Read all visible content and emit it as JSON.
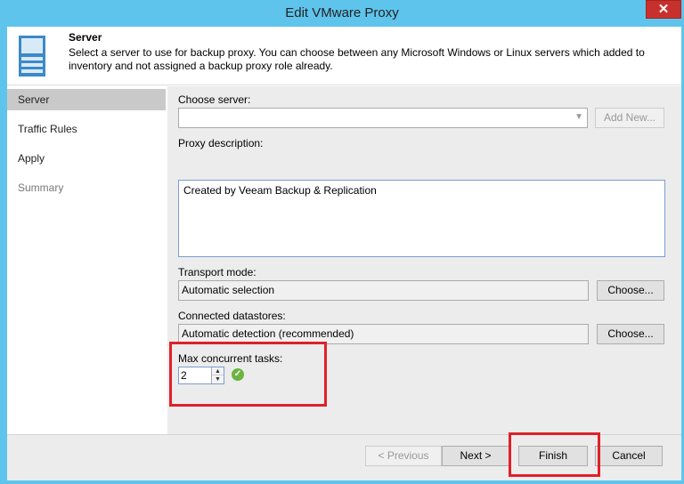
{
  "window": {
    "title": "Edit VMware Proxy",
    "close_glyph": "✕"
  },
  "header": {
    "title": "Server",
    "description": "Select a server to use for backup proxy. You can choose between any Microsoft Windows or Linux servers which added to inventory and not assigned a backup proxy role already.",
    "icon": "server-icon"
  },
  "nav": {
    "items": [
      {
        "label": "Server",
        "state": "active"
      },
      {
        "label": "Traffic Rules",
        "state": "normal"
      },
      {
        "label": "Apply",
        "state": "normal"
      },
      {
        "label": "Summary",
        "state": "disabled"
      }
    ]
  },
  "form": {
    "choose_server_label": "Choose server:",
    "choose_server_value": "",
    "add_new_label": "Add New...",
    "proxy_description_label": "Proxy description:",
    "proxy_description_value": "Created by Veeam Backup & Replication",
    "transport_mode_label": "Transport mode:",
    "transport_mode_value": "Automatic selection",
    "choose_label": "Choose...",
    "connected_datastores_label": "Connected datastores:",
    "connected_datastores_value": "Automatic detection (recommended)",
    "max_tasks_label": "Max concurrent tasks:",
    "max_tasks_value": "2"
  },
  "footer": {
    "previous_label": "< Previous",
    "next_label": "Next >",
    "finish_label": "Finish",
    "cancel_label": "Cancel"
  },
  "colors": {
    "titlebar": "#5fc4ec",
    "highlight": "#e0202a",
    "close": "#c7302c",
    "ok": "#6cb33f"
  }
}
